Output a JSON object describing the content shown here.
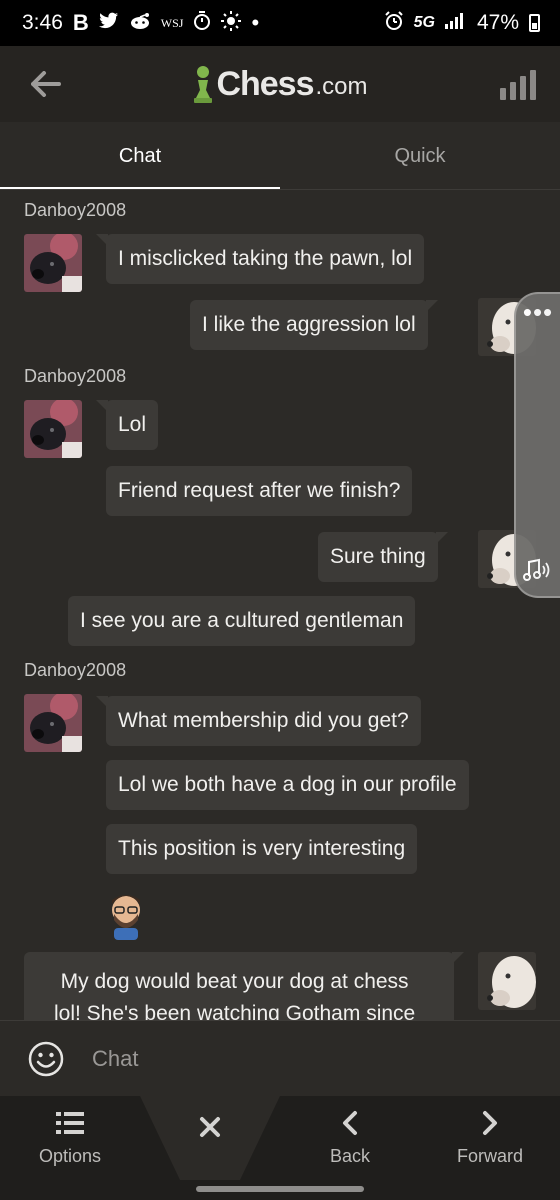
{
  "status_bar": {
    "time": "3:46",
    "left_icons": [
      "B",
      "twitter-icon",
      "reddit-icon",
      "WSJ",
      "timer-icon",
      "sun-icon",
      "•"
    ],
    "network": "5G",
    "battery": "47%"
  },
  "header": {
    "logo_brand": "Chess",
    "logo_tld": ".com"
  },
  "tabs": [
    {
      "label": "Chat",
      "active": true
    },
    {
      "label": "Quick",
      "active": false
    }
  ],
  "messages": {
    "user1": "Danboy2008",
    "user2": "Danboy2008",
    "user3": "Danboy2008",
    "m1": "I misclicked taking the pawn, lol",
    "m2": "I like the aggression lol",
    "m3": "Lol",
    "m4": "Friend request after we finish?",
    "m5": "Sure thing",
    "m6": "I see you are a cultured gentleman",
    "m7": "What membership did you get?",
    "m8": "Lol we both have a dog in our profile",
    "m9": "This position is very interesting",
    "m10_line1": "My dog would beat your dog at chess",
    "m10_line2": "lol! She's been watching Gotham since"
  },
  "input": {
    "placeholder": "Chat"
  },
  "bottom_nav": [
    {
      "label": "Options"
    },
    {
      "label": ""
    },
    {
      "label": "Back"
    },
    {
      "label": "Forward"
    }
  ],
  "colors": {
    "background": "#2c2a27",
    "bubble": "#3c3a37",
    "logo_green": "#81b64c"
  }
}
